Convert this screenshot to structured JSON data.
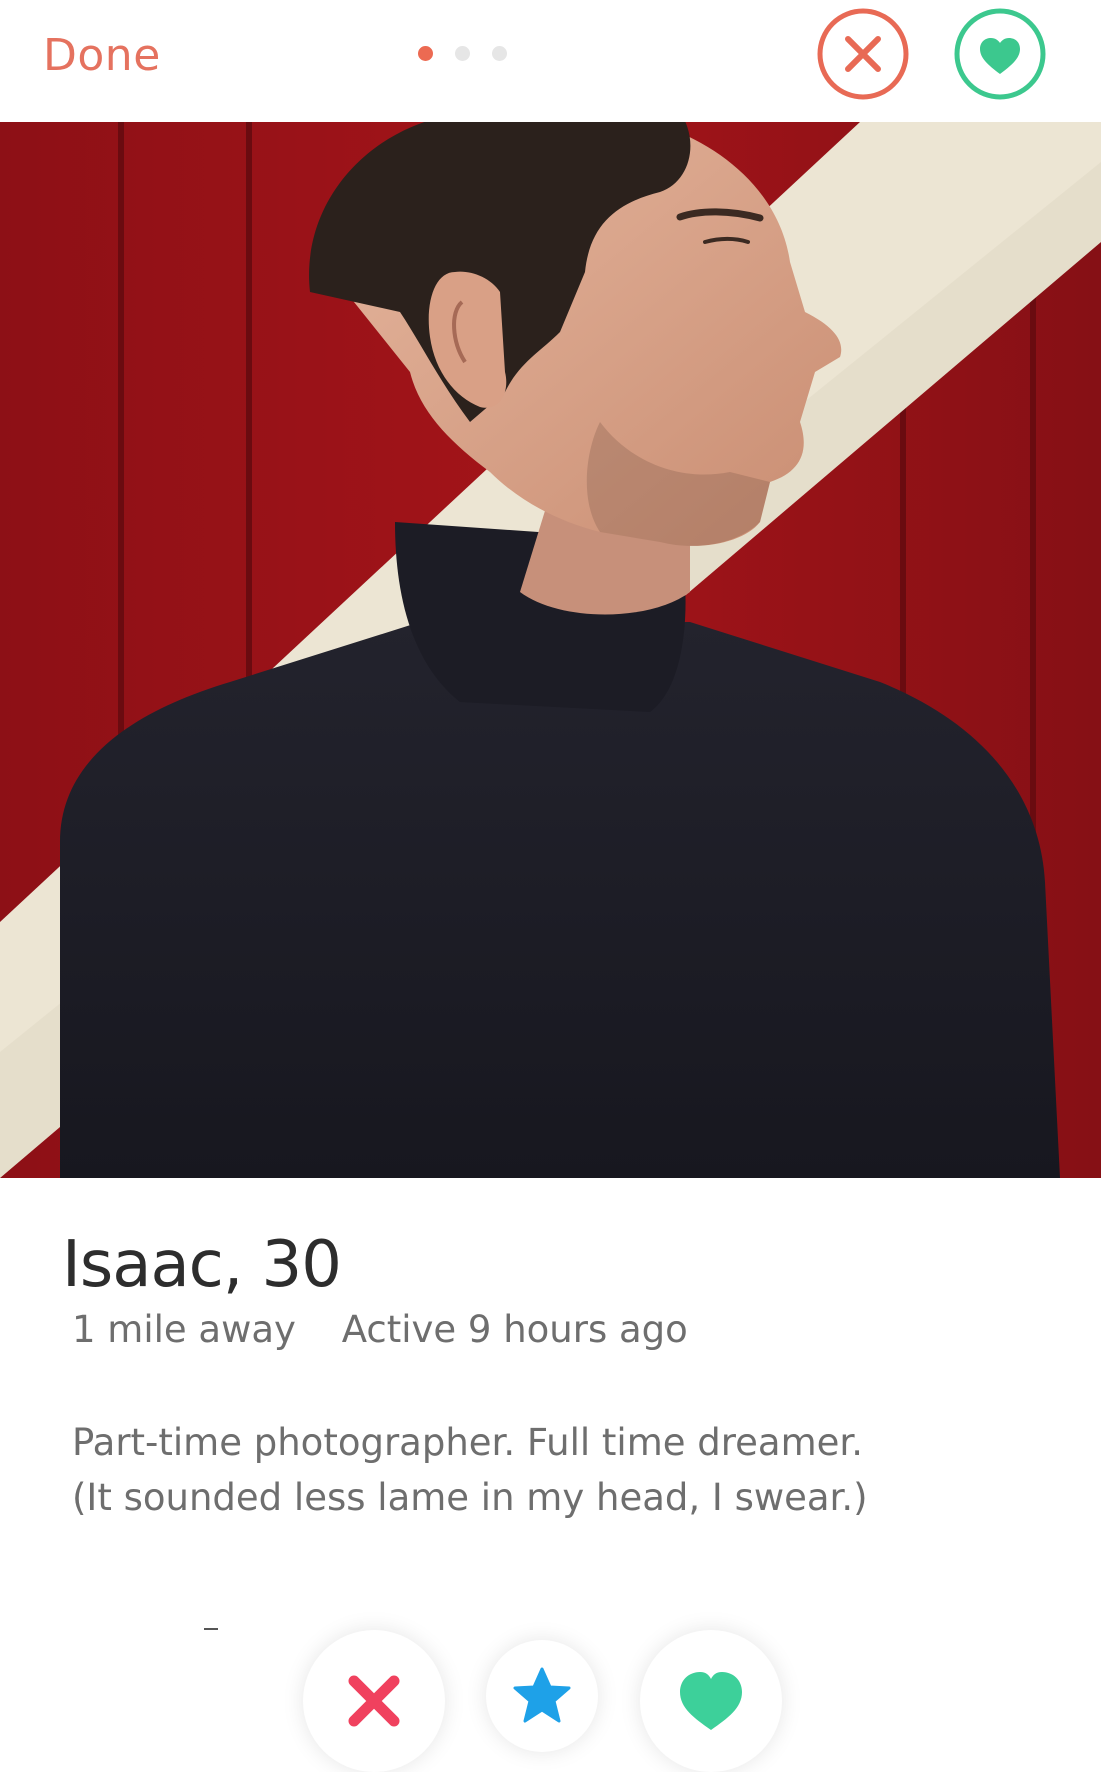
{
  "header": {
    "done_label": "Done",
    "page_dots": {
      "count": 3,
      "active_index": 0
    },
    "nope_icon": "close-circle-icon",
    "like_icon": "heart-circle-icon"
  },
  "profile": {
    "name_age": "Isaac, 30",
    "distance": "1 mile away",
    "activity": "Active 9 hours ago",
    "bio_lines": [
      "Part-time photographer. Full time dreamer.",
      "(It sounded less lame in my head, I swear.)"
    ],
    "photo_description_icon": "profile-photo"
  },
  "actions": {
    "nope_icon": "close-icon",
    "super_like_icon": "star-icon",
    "like_icon": "heart-icon"
  },
  "colors": {
    "accent_red": "#ec6a52",
    "like_green": "#3dd09a",
    "star_blue": "#1ea1e8",
    "nope_pink": "#f0415e",
    "text_dark": "#2d2d2d",
    "text_gray": "#6e6e6e"
  }
}
